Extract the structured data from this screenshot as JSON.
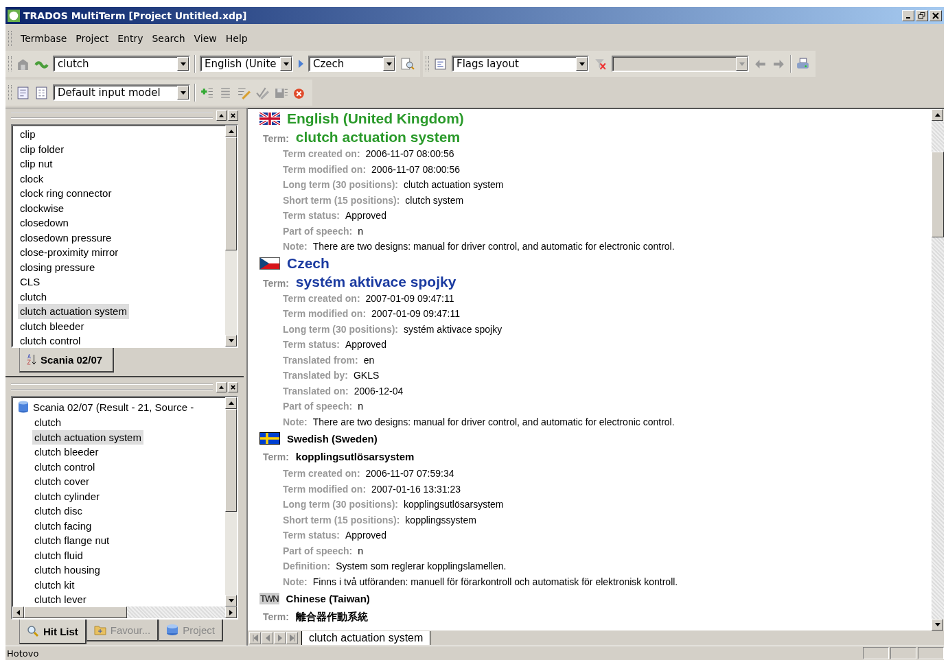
{
  "window": {
    "title": "TRADOS MultiTerm [Project Untitled.xdp]"
  },
  "menu": [
    "Termbase",
    "Project",
    "Entry",
    "Search",
    "View",
    "Help"
  ],
  "toolbar": {
    "search_value": "clutch",
    "source_language": "English (Unite",
    "target_language": "Czech",
    "layout": "Flags layout",
    "input_model": "Default input model"
  },
  "browse_panel": {
    "items": [
      {
        "label": "clip",
        "selected": false
      },
      {
        "label": "clip folder",
        "selected": false
      },
      {
        "label": "clip nut",
        "selected": false
      },
      {
        "label": "clock",
        "selected": false
      },
      {
        "label": "clock ring connector",
        "selected": false
      },
      {
        "label": "clockwise",
        "selected": false
      },
      {
        "label": "closedown",
        "selected": false
      },
      {
        "label": "closedown pressure",
        "selected": false
      },
      {
        "label": "close-proximity mirror",
        "selected": false
      },
      {
        "label": "closing pressure",
        "selected": false
      },
      {
        "label": "CLS",
        "selected": false
      },
      {
        "label": "clutch",
        "selected": false
      },
      {
        "label": "clutch actuation system",
        "selected": true
      },
      {
        "label": "clutch bleeder",
        "selected": false
      },
      {
        "label": "clutch control",
        "selected": false
      }
    ],
    "tab": "Scania 02/07"
  },
  "hit_panel": {
    "root": "Scania 02/07 (Result - 21, Source -",
    "items": [
      {
        "label": "clutch",
        "selected": false
      },
      {
        "label": "clutch actuation system",
        "selected": true
      },
      {
        "label": "clutch bleeder",
        "selected": false
      },
      {
        "label": "clutch control",
        "selected": false
      },
      {
        "label": "clutch cover",
        "selected": false
      },
      {
        "label": "clutch cylinder",
        "selected": false
      },
      {
        "label": "clutch disc",
        "selected": false
      },
      {
        "label": "clutch facing",
        "selected": false
      },
      {
        "label": "clutch flange nut",
        "selected": false
      },
      {
        "label": "clutch fluid",
        "selected": false
      },
      {
        "label": "clutch housing",
        "selected": false
      },
      {
        "label": "clutch kit",
        "selected": false
      },
      {
        "label": "clutch lever",
        "selected": false
      }
    ],
    "tabs": [
      {
        "label": "Hit List",
        "kind": "search",
        "selected": true
      },
      {
        "label": "Favour...",
        "kind": "folder",
        "selected": false
      },
      {
        "label": "Project",
        "kind": "database",
        "selected": false
      }
    ]
  },
  "entry": {
    "languages": [
      {
        "name": "English (United Kingdom)",
        "kind": "uk",
        "source": true,
        "target": false,
        "term_label": "Term:",
        "term": "clutch actuation system",
        "fields": [
          {
            "label": "Term created on:",
            "value": "2006-11-07 08:00:56"
          },
          {
            "label": "Term modified on:",
            "value": "2006-11-07 08:00:56"
          },
          {
            "label": "Long term (30 positions):",
            "value": "clutch actuation system"
          },
          {
            "label": "Short term (15 positions):",
            "value": "clutch system"
          },
          {
            "label": "Term status:",
            "value": "Approved"
          },
          {
            "label": "Part of speech:",
            "value": "n"
          },
          {
            "label": "Note:",
            "value": "There are two designs: manual for driver control, and automatic for electronic control."
          }
        ]
      },
      {
        "name": "Czech",
        "kind": "cz",
        "source": false,
        "target": true,
        "term_label": "Term:",
        "term": "systém aktivace spojky",
        "fields": [
          {
            "label": "Term created on:",
            "value": "2007-01-09 09:47:11"
          },
          {
            "label": "Term modified on:",
            "value": "2007-01-09 09:47:11"
          },
          {
            "label": "Long term (30 positions):",
            "value": "systém aktivace spojky"
          },
          {
            "label": "Term status:",
            "value": "Approved"
          },
          {
            "label": "Translated from:",
            "value": "en"
          },
          {
            "label": "Translated by:",
            "value": "GKLS"
          },
          {
            "label": "Translated on:",
            "value": "2006-12-04"
          },
          {
            "label": "Part of speech:",
            "value": "n"
          },
          {
            "label": "Note:",
            "value": "There are two designs: manual for driver control, and automatic for electronic control."
          }
        ]
      },
      {
        "name": "Swedish (Sweden)",
        "kind": "se",
        "source": false,
        "target": false,
        "term_label": "Term:",
        "term": "kopplingsutlösarsystem",
        "fields": [
          {
            "label": "Term created on:",
            "value": "2006-11-07 07:59:34"
          },
          {
            "label": "Term modified on:",
            "value": "2007-01-16 13:31:23"
          },
          {
            "label": "Long term (30 positions):",
            "value": "kopplingsutlösarsystem"
          },
          {
            "label": "Short term (15 positions):",
            "value": "kopplingssystem"
          },
          {
            "label": "Term status:",
            "value": "Approved"
          },
          {
            "label": "Part of speech:",
            "value": "n"
          },
          {
            "label": "Definition:",
            "value": "System som reglerar kopplingslamellen."
          },
          {
            "label": "Note:",
            "value": "Finns i två utföranden: manuell för förarkontroll och automatisk för elektronisk kontroll."
          }
        ]
      },
      {
        "name": "Chinese (Taiwan)",
        "kind": "code",
        "flag_text": "TWN",
        "source": false,
        "target": false,
        "term_label": "Term:",
        "term": "離合器作動系統"
      }
    ],
    "tab": "clutch actuation system"
  },
  "status_bar": "Hotovo"
}
